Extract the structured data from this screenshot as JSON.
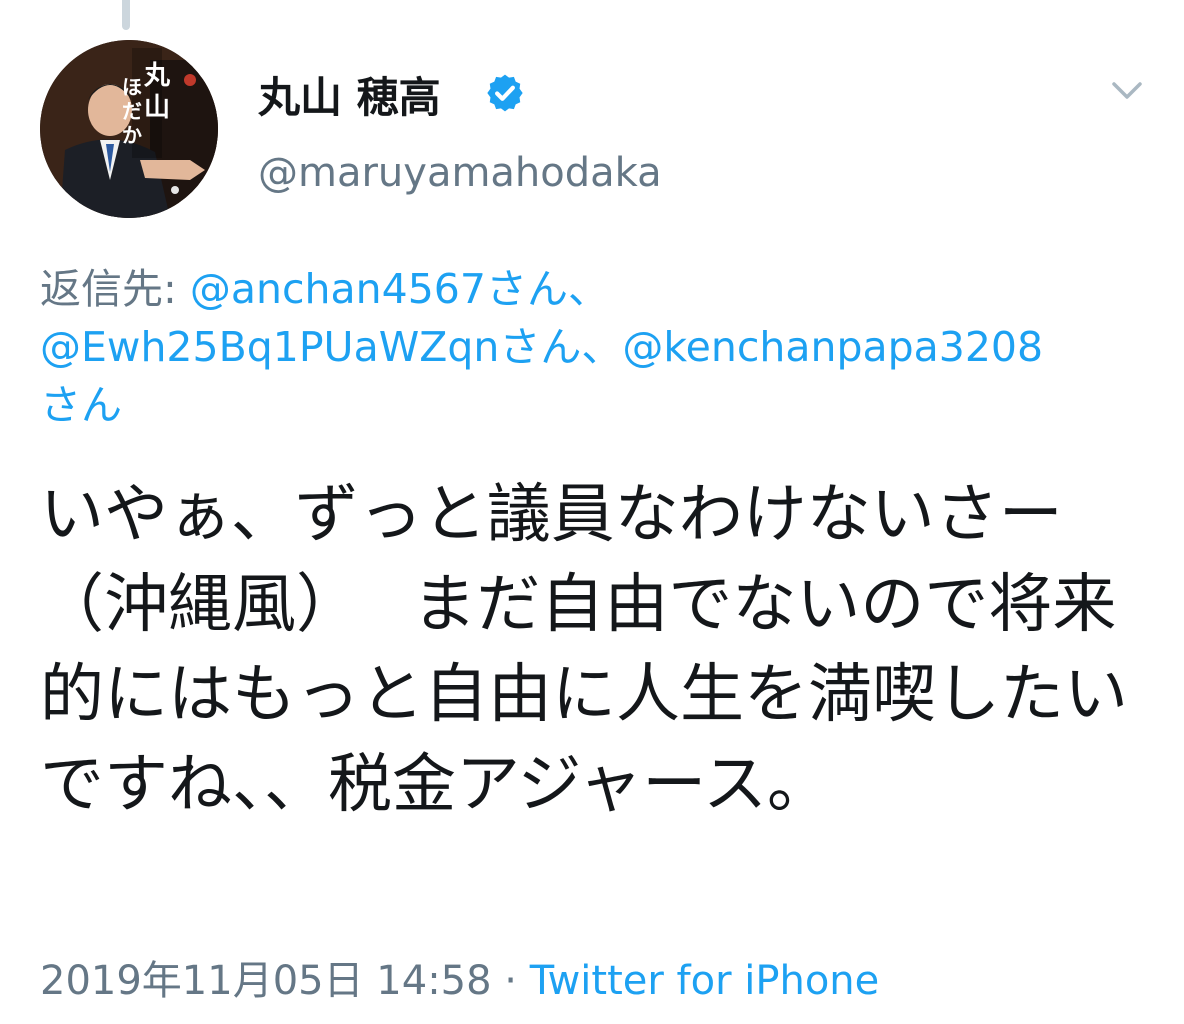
{
  "tweet": {
    "author": {
      "display_name": "丸山 穂高",
      "handle": "@maruyamahodaka",
      "avatar_text": [
        "丸",
        "山",
        "ほ",
        "だ",
        "か"
      ]
    },
    "reply_to": {
      "prefix": "返信先: ",
      "mentions": [
        "@anchan4567さん、",
        "@Ewh25Bq1PUaWZqnさん、",
        "@kenchanpapa3208",
        "さん"
      ]
    },
    "text": "いやぁ、ずっと議員なわけないさー（沖縄風）　 まだ自由でないので将来的にはもっと自由に人生を満喫したいですね、、税金アジャース。",
    "timestamp": "2019年11月05日 14:58",
    "separator": " · ",
    "source": "Twitter for iPhone"
  },
  "colors": {
    "link": "#1da1f2",
    "secondary": "#657786",
    "text": "#14171a"
  },
  "icons": [
    "verified-icon",
    "chevron-down-icon"
  ]
}
